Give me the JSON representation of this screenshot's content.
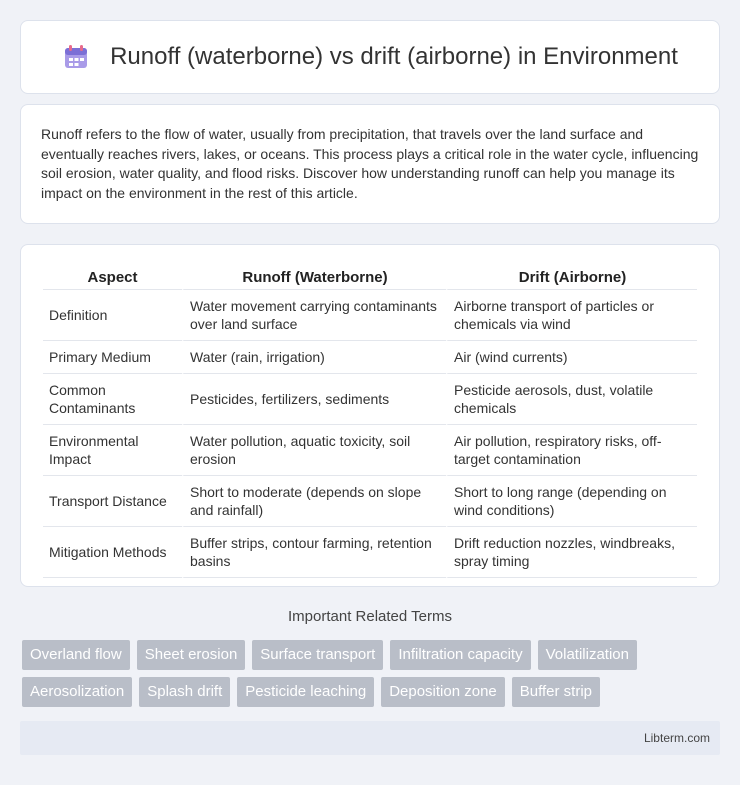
{
  "header": {
    "title": "Runoff (waterborne) vs drift (airborne) in Environment",
    "icon": "calendar-icon"
  },
  "intro": {
    "text": "Runoff refers to the flow of water, usually from precipitation, that travels over the land surface and eventually reaches rivers, lakes, or oceans. This process plays a critical role in the water cycle, influencing soil erosion, water quality, and flood risks. Discover how understanding runoff can help you manage its impact on the environment in the rest of this article."
  },
  "table": {
    "headers": [
      "Aspect",
      "Runoff (Waterborne)",
      "Drift (Airborne)"
    ],
    "rows": [
      [
        "Definition",
        "Water movement carrying contaminants over land surface",
        "Airborne transport of particles or chemicals via wind"
      ],
      [
        "Primary Medium",
        "Water (rain, irrigation)",
        "Air (wind currents)"
      ],
      [
        "Common Contaminants",
        "Pesticides, fertilizers, sediments",
        "Pesticide aerosols, dust, volatile chemicals"
      ],
      [
        "Environmental Impact",
        "Water pollution, aquatic toxicity, soil erosion",
        "Air pollution, respiratory risks, off-target contamination"
      ],
      [
        "Transport Distance",
        "Short to moderate (depends on slope and rainfall)",
        "Short to long range (depending on wind conditions)"
      ],
      [
        "Mitigation Methods",
        "Buffer strips, contour farming, retention basins",
        "Drift reduction nozzles, windbreaks, spray timing"
      ]
    ]
  },
  "related": {
    "heading": "Important Related Terms",
    "row1": [
      "Overland flow",
      "Sheet erosion",
      "Surface transport",
      "Infiltration capacity",
      "Volatilization"
    ],
    "row2": [
      "Aerosolization",
      "Splash drift",
      "Pesticide leaching",
      "Deposition zone",
      "Buffer strip"
    ]
  },
  "footer": {
    "text": "Libterm.com"
  },
  "colors": {
    "tag_bg": "#b9bec8",
    "background": "#f0f2f7",
    "icon_accent": "#7b6fd6"
  }
}
